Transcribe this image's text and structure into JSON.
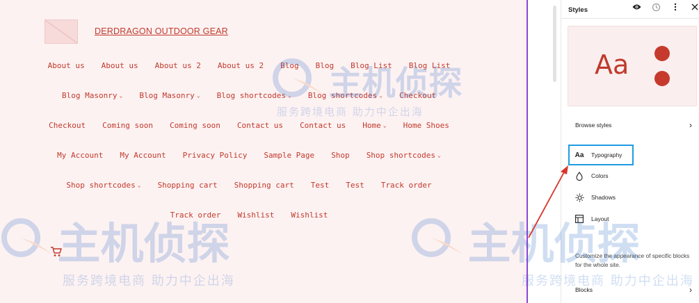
{
  "site": {
    "title": "DERDRAGON OUTDOOR GEAR"
  },
  "nav": [
    {
      "label": "About us",
      "dropdown": false
    },
    {
      "label": "About us",
      "dropdown": false
    },
    {
      "label": "About us 2",
      "dropdown": false
    },
    {
      "label": "About us 2",
      "dropdown": false
    },
    {
      "label": "Blog",
      "dropdown": false
    },
    {
      "label": "Blog",
      "dropdown": false
    },
    {
      "label": "Blog List",
      "dropdown": false
    },
    {
      "label": "Blog List",
      "dropdown": false
    },
    {
      "label": "Blog Masonry",
      "dropdown": true
    },
    {
      "label": "Blog Masonry",
      "dropdown": true
    },
    {
      "label": "Blog shortcodes",
      "dropdown": true
    },
    {
      "label": "Blog shortcodes",
      "dropdown": true
    },
    {
      "label": "Checkout",
      "dropdown": false
    },
    {
      "label": "Checkout",
      "dropdown": false
    },
    {
      "label": "Coming soon",
      "dropdown": false
    },
    {
      "label": "Coming soon",
      "dropdown": false
    },
    {
      "label": "Contact us",
      "dropdown": false
    },
    {
      "label": "Contact us",
      "dropdown": false
    },
    {
      "label": "Home",
      "dropdown": true
    },
    {
      "label": "Home Shoes",
      "dropdown": false
    },
    {
      "label": "My Account",
      "dropdown": false
    },
    {
      "label": "My Account",
      "dropdown": false
    },
    {
      "label": "Privacy Policy",
      "dropdown": false
    },
    {
      "label": "Sample Page",
      "dropdown": false
    },
    {
      "label": "Shop",
      "dropdown": false
    },
    {
      "label": "Shop shortcodes",
      "dropdown": true
    },
    {
      "label": "Shop shortcodes",
      "dropdown": true
    },
    {
      "label": "Shopping cart",
      "dropdown": false
    },
    {
      "label": "Shopping cart",
      "dropdown": false
    },
    {
      "label": "Test",
      "dropdown": false
    },
    {
      "label": "Test",
      "dropdown": false
    },
    {
      "label": "Track order",
      "dropdown": false
    },
    {
      "label": "Track order",
      "dropdown": false
    },
    {
      "label": "Wishlist",
      "dropdown": false
    },
    {
      "label": "Wishlist",
      "dropdown": false
    }
  ],
  "panel": {
    "title": "Styles",
    "header_icons": [
      "eye-icon",
      "revisions-icon",
      "more-options-icon",
      "close-icon"
    ],
    "preview": {
      "text": "Aa",
      "accent": "#c63a2e",
      "background": "#fbeeee"
    },
    "browse_styles": "Browse styles",
    "items": [
      {
        "icon": "typography-icon",
        "icon_glyph": "Aa",
        "label": "Typography",
        "highlighted": true
      },
      {
        "icon": "colors-icon",
        "icon_glyph": "",
        "label": "Colors",
        "highlighted": false
      },
      {
        "icon": "shadows-icon",
        "icon_glyph": "",
        "label": "Shadows",
        "highlighted": false
      },
      {
        "icon": "layout-icon",
        "icon_glyph": "",
        "label": "Layout",
        "highlighted": false
      }
    ],
    "customize_text": "Customize the appearance of specific blocks for the whole site.",
    "blocks": "Blocks"
  },
  "watermark": {
    "big_text": "主机侦探",
    "small_text": "服务跨境电商 助力中企出海"
  },
  "colors": {
    "accent": "#c0392b",
    "canvas_bg": "#fdf2f2",
    "highlight_box": "#1e9ce0",
    "canvas_border": "#8e44d9",
    "annotation_arrow": "#d9342b"
  }
}
